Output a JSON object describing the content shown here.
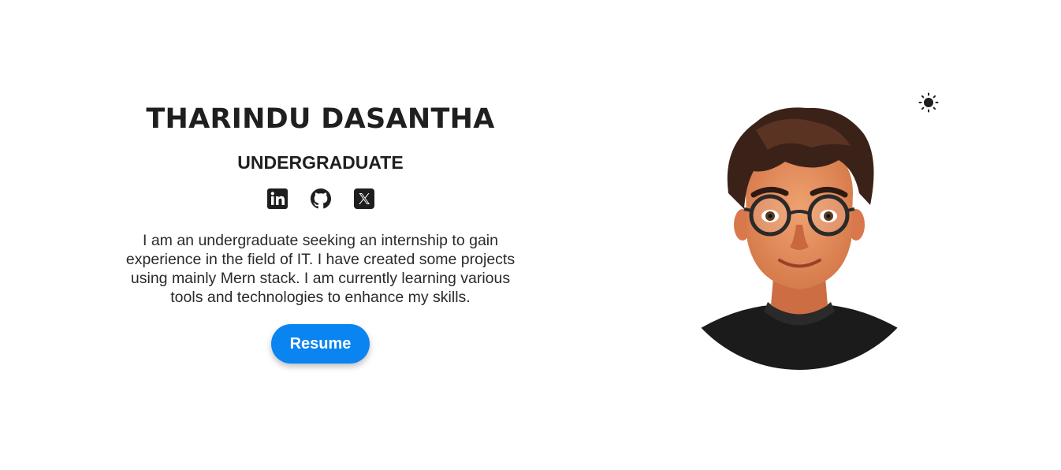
{
  "header": {
    "theme_toggle_icon": "sun-icon"
  },
  "hero": {
    "name": "THARINDU DASANTHA",
    "role": "UNDERGRADUATE",
    "socials": [
      {
        "icon": "linkedin-icon",
        "label": "LinkedIn"
      },
      {
        "icon": "github-icon",
        "label": "GitHub"
      },
      {
        "icon": "x-icon",
        "label": "X"
      }
    ],
    "bio": "I am an undergraduate seeking an internship to gain experience in the field of IT. I have created some projects using mainly Mern stack. I am currently learning various tools and technologies to enhance my skills.",
    "resume_label": "Resume"
  },
  "colors": {
    "accent": "#0a84f0",
    "text": "#1f1f1f",
    "background": "#ffffff"
  }
}
